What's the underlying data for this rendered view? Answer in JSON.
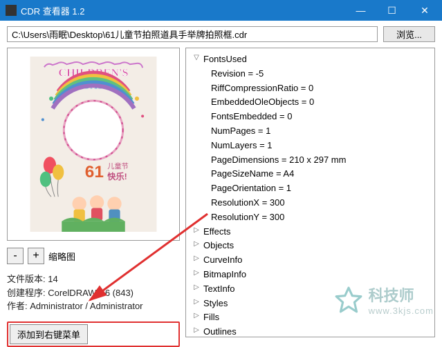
{
  "window": {
    "title": "CDR 查看器 1.2"
  },
  "path": {
    "value": "C:\\Users\\雨眠\\Desktop\\61儿童节拍照道具手举牌拍照框.cdr",
    "browse_label": "浏览..."
  },
  "thumb": {
    "minus": "-",
    "plus": "+",
    "label": "缩略图"
  },
  "info": {
    "version_label": "文件版本: ",
    "version_value": "14",
    "creator_label": "创建程序: ",
    "creator_value": "CorelDRAW X6 (843)",
    "author_label": "作者: ",
    "author_value": "Administrator / Administrator"
  },
  "add_button": "添加到右键菜单",
  "tree": {
    "fonts_used": "FontsUsed",
    "children": {
      "revision": "Revision = -5",
      "riff": "RiffCompressionRatio = 0",
      "embedded": "EmbeddedOleObjects = 0",
      "fonts_emb": "FontsEmbedded = 0",
      "num_pages": "NumPages = 1",
      "num_layers": "NumLayers = 1",
      "page_dim": "PageDimensions = 210 x 297 mm",
      "page_size": "PageSizeName = A4",
      "page_orient": "PageOrientation = 1",
      "res_x": "ResolutionX = 300",
      "res_y": "ResolutionY = 300"
    },
    "effects": "Effects",
    "objects": "Objects",
    "curve": "CurveInfo",
    "bitmap": "BitmapInfo",
    "text": "TextInfo",
    "styles": "Styles",
    "fills": "Fills",
    "outlines": "Outlines"
  },
  "watermark": {
    "title": "科技师",
    "sub": "www.3kjs.com"
  }
}
